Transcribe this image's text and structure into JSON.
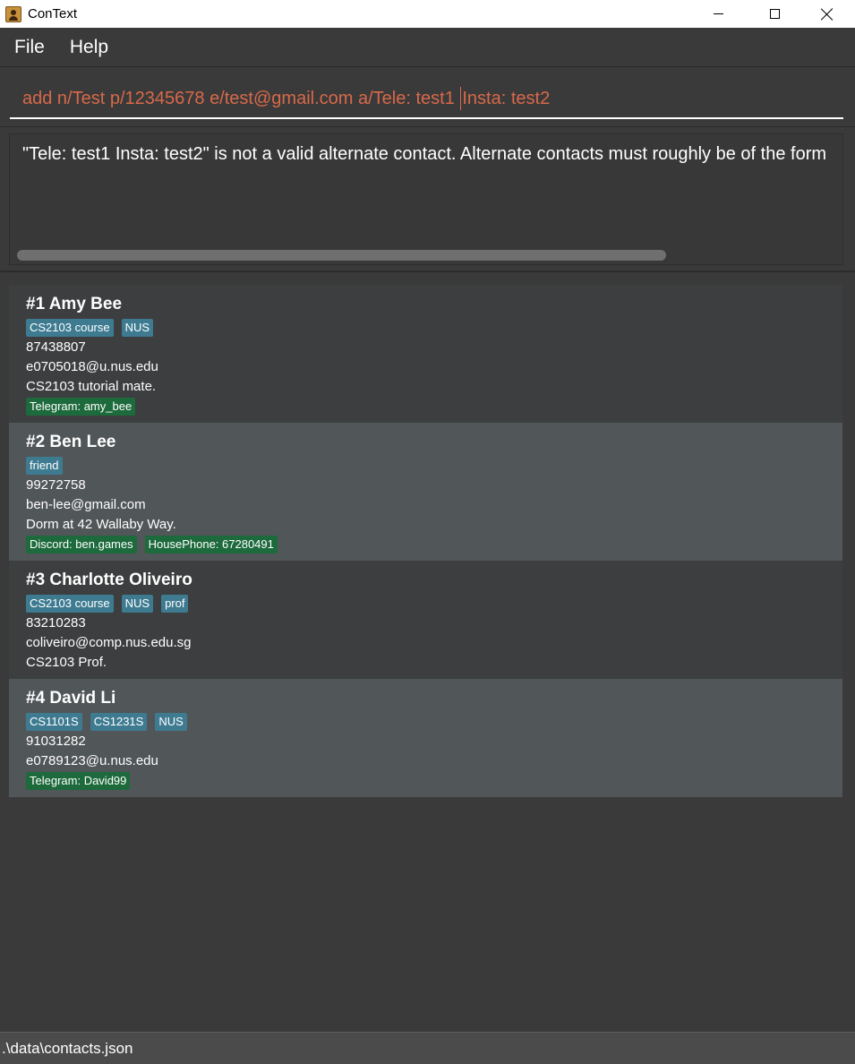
{
  "window": {
    "title": "ConText",
    "icon": "contacts-book-icon"
  },
  "menu": {
    "items": [
      "File",
      "Help"
    ]
  },
  "command": {
    "value_before_caret": "add n/Test p/12345678 e/test@gmail.com a/Tele: test1 ",
    "value_after_caret": "Insta: test2",
    "text_color": "#d8694a"
  },
  "result": {
    "message": "\"Tele: test1 Insta: test2\" is not a valid alternate contact. Alternate contacts must roughly be of the form"
  },
  "persons": [
    {
      "heading": "#1 Amy Bee",
      "tags": [
        "CS2103 course",
        "NUS"
      ],
      "phone": "87438807",
      "email": "e0705018@u.nus.edu",
      "note": "CS2103 tutorial mate.",
      "alternates": [
        "Telegram: amy_bee"
      ]
    },
    {
      "heading": "#2 Ben Lee",
      "tags": [
        "friend"
      ],
      "phone": "99272758",
      "email": "ben-lee@gmail.com",
      "note": "Dorm at 42 Wallaby Way.",
      "alternates": [
        "Discord: ben.games",
        "HousePhone: 67280491"
      ]
    },
    {
      "heading": "#3 Charlotte Oliveiro",
      "tags": [
        "CS2103 course",
        "NUS",
        "prof"
      ],
      "phone": "83210283",
      "email": "coliveiro@comp.nus.edu.sg",
      "note": "CS2103 Prof.",
      "alternates": []
    },
    {
      "heading": "#4 David Li",
      "tags": [
        "CS1101S",
        "CS1231S",
        "NUS"
      ],
      "phone": "91031282",
      "email": "e0789123@u.nus.edu",
      "note": "",
      "alternates": [
        "Telegram: David99"
      ]
    }
  ],
  "status": {
    "path": ".\\data\\contacts.json"
  },
  "colors": {
    "background": "#3a3a3a",
    "tag": "#3e7b91",
    "alternate_tag": "#1d6a3c",
    "card_odd": "#3c3e3f",
    "card_even": "#515658"
  }
}
